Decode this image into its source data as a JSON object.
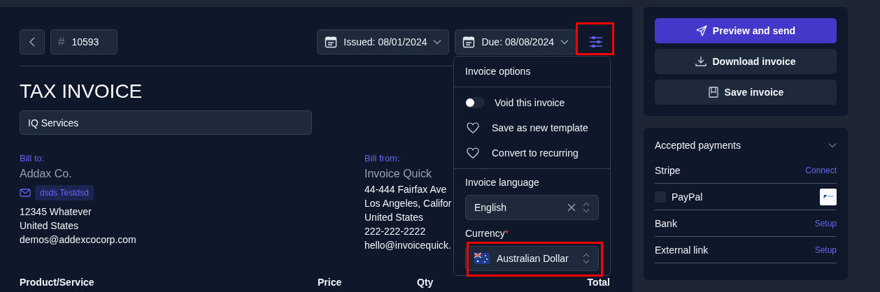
{
  "invoice_number": {
    "prefix": "#",
    "value": "10593"
  },
  "dates": [
    {
      "label": "Issued: 08/01/2024"
    },
    {
      "label": "Due: 08/08/2024"
    }
  ],
  "options_button": {
    "highlighted": true
  },
  "title": "TAX INVOICE",
  "company_field": {
    "value": "IQ Services"
  },
  "bill_to": {
    "label": "Bill to:",
    "name": "Addax Co.",
    "contact_tag": "dsds Testdsd",
    "lines": [
      "12345 Whatever",
      "United States",
      "demos@addexcocorp.com"
    ]
  },
  "bill_from": {
    "label": "Bill from:",
    "name": "Invoice Quick",
    "lines": [
      "44-444 Fairfax Ave",
      "Los Angeles, Califor",
      "United States",
      "222-222-2222",
      "hello@invoicequick."
    ]
  },
  "table": {
    "columns": [
      "Product/Service",
      "Price",
      "Qty",
      "Total"
    ]
  },
  "options_menu": {
    "title": "Invoice options",
    "items": [
      {
        "kind": "toggle",
        "label": "Void this invoice",
        "on": false
      },
      {
        "kind": "action",
        "label": "Save as new template"
      },
      {
        "kind": "action",
        "label": "Convert to recurring"
      }
    ],
    "language": {
      "label": "Invoice language",
      "value": "English"
    },
    "currency": {
      "label": "Currency",
      "required_mark": "*",
      "value": "Australian Dollar",
      "highlighted": true
    }
  },
  "actions": [
    {
      "kind": "primary",
      "label": "Preview and send"
    },
    {
      "kind": "secondary",
      "label": "Download invoice"
    },
    {
      "kind": "secondary",
      "label": "Save invoice"
    }
  ],
  "payments": {
    "title": "Accepted payments",
    "methods": [
      {
        "kind": "link",
        "name": "Stripe",
        "action": "Connect"
      },
      {
        "kind": "checkbox",
        "name": "PayPal",
        "checked": false
      },
      {
        "kind": "link",
        "name": "Bank",
        "action": "Setup"
      },
      {
        "kind": "link",
        "name": "External link",
        "action": "Setup"
      }
    ]
  }
}
